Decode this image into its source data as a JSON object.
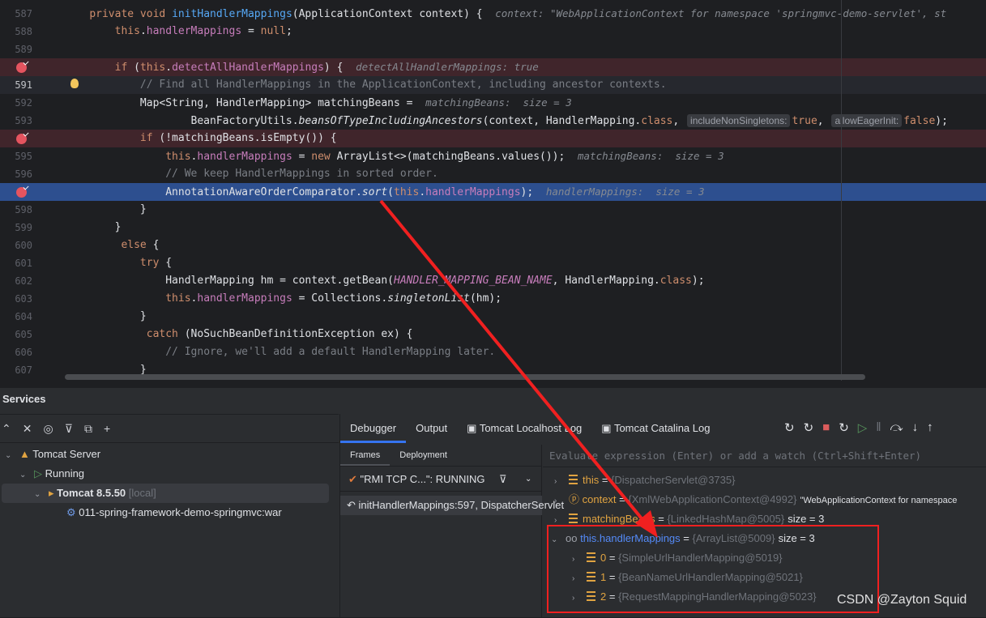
{
  "editor": {
    "lines": [
      {
        "num": "587",
        "t": [
          [
            "",
            "    "
          ],
          [
            "kw",
            "private void "
          ],
          [
            "md",
            "initHandlerMappings"
          ],
          [
            "",
            "(ApplicationContext context) {  "
          ],
          [
            "hint",
            "context: \"WebApplicationContext for namespace 'springmvc-demo-servlet', st"
          ]
        ]
      },
      {
        "num": "588",
        "t": [
          [
            "",
            "        "
          ],
          [
            "kw",
            "this"
          ],
          [
            "",
            "."
          ],
          [
            "fd",
            "handlerMappings"
          ],
          [
            "",
            " = "
          ],
          [
            "kw",
            "null"
          ],
          [
            "",
            ";"
          ]
        ]
      },
      {
        "num": "589",
        "t": []
      },
      {
        "num": "590",
        "bp": true,
        "t": [
          [
            "",
            "        "
          ],
          [
            "kw",
            "if "
          ],
          [
            "",
            "("
          ],
          [
            "kw",
            "this"
          ],
          [
            "",
            "."
          ],
          [
            "fd",
            "detectAllHandlerMappings"
          ],
          [
            "",
            ") {  "
          ],
          [
            "hint",
            "detectAllHandlerMappings: true"
          ]
        ]
      },
      {
        "num": "591",
        "caret": true,
        "bulb": true,
        "t": [
          [
            "",
            "            "
          ],
          [
            "cm",
            "// Find all HandlerMappings in the ApplicationContext, including ancestor contexts."
          ]
        ]
      },
      {
        "num": "592",
        "t": [
          [
            "",
            "            Map<String, HandlerMapping> matchingBeans =  "
          ],
          [
            "hint",
            "matchingBeans:  size = 3"
          ]
        ]
      },
      {
        "num": "593",
        "t": [
          [
            "",
            "                    BeanFactoryUtils."
          ],
          [
            "it",
            "beansOfTypeIncludingAncestors"
          ],
          [
            "",
            "(context, HandlerMapping."
          ],
          [
            "kw",
            "class"
          ],
          [
            "",
            ", "
          ],
          [
            "pill",
            "includeNonSingletons:"
          ],
          [
            "kw",
            "true"
          ],
          [
            "",
            ", "
          ],
          [
            "pill",
            "allowEagerInit:"
          ],
          [
            "kw",
            "false"
          ],
          [
            "",
            ");"
          ]
        ]
      },
      {
        "num": "594",
        "bp": true,
        "t": [
          [
            "",
            "            "
          ],
          [
            "kw",
            "if "
          ],
          [
            "",
            "(!matchingBeans.isEmpty()) {"
          ]
        ]
      },
      {
        "num": "595",
        "t": [
          [
            "",
            "                "
          ],
          [
            "kw",
            "this"
          ],
          [
            "",
            "."
          ],
          [
            "fd",
            "handlerMappings"
          ],
          [
            "",
            " = "
          ],
          [
            "kw",
            "new "
          ],
          [
            "",
            "ArrayList<>(matchingBeans.values());  "
          ],
          [
            "hint",
            "matchingBeans:  size = 3"
          ]
        ]
      },
      {
        "num": "596",
        "t": [
          [
            "",
            "                "
          ],
          [
            "cm",
            "// We keep HandlerMappings in sorted order."
          ]
        ]
      },
      {
        "num": "597",
        "bp": true,
        "exec": true,
        "t": [
          [
            "",
            "                AnnotationAwareOrderComparator."
          ],
          [
            "it",
            "sort"
          ],
          [
            "",
            "("
          ],
          [
            "kw",
            "this"
          ],
          [
            "",
            "."
          ],
          [
            "fd",
            "handlerMappings"
          ],
          [
            "",
            ");  "
          ],
          [
            "hint",
            "handlerMappings:  size = 3"
          ]
        ]
      },
      {
        "num": "598",
        "t": [
          [
            "",
            "            }"
          ]
        ]
      },
      {
        "num": "599",
        "t": [
          [
            "",
            "        }"
          ]
        ]
      },
      {
        "num": "600",
        "t": [
          [
            "",
            "         "
          ],
          [
            "kw",
            "else "
          ],
          [
            "",
            "{"
          ]
        ]
      },
      {
        "num": "601",
        "t": [
          [
            "",
            "            "
          ],
          [
            "kw",
            "try "
          ],
          [
            "",
            "{"
          ]
        ]
      },
      {
        "num": "602",
        "t": [
          [
            "",
            "                HandlerMapping hm = context.getBean("
          ],
          [
            "fd it",
            "HANDLER_MAPPING_BEAN_NAME"
          ],
          [
            "",
            ", HandlerMapping."
          ],
          [
            "kw",
            "class"
          ],
          [
            "",
            ");"
          ]
        ]
      },
      {
        "num": "603",
        "t": [
          [
            "",
            "                "
          ],
          [
            "kw",
            "this"
          ],
          [
            "",
            "."
          ],
          [
            "fd",
            "handlerMappings"
          ],
          [
            "",
            " = Collections."
          ],
          [
            "it",
            "singletonList"
          ],
          [
            "",
            "(hm);"
          ]
        ]
      },
      {
        "num": "604",
        "t": [
          [
            "",
            "            }"
          ]
        ]
      },
      {
        "num": "605",
        "t": [
          [
            "",
            "             "
          ],
          [
            "kw",
            "catch "
          ],
          [
            "",
            "(NoSuchBeanDefinitionException ex) {"
          ]
        ]
      },
      {
        "num": "606",
        "t": [
          [
            "",
            "                "
          ],
          [
            "cm",
            "// Ignore, we'll add a default HandlerMapping later."
          ]
        ]
      },
      {
        "num": "607",
        "t": [
          [
            "",
            "            }"
          ]
        ]
      }
    ]
  },
  "services": {
    "title": "Services",
    "tree": {
      "server": "Tomcat Server",
      "running": "Running",
      "tomcat": "Tomcat 8.5.50",
      "tomcat_tag": "[local]",
      "artifact": "011-spring-framework-demo-springmvc:war"
    },
    "tabs": [
      "Debugger",
      "Output",
      "Tomcat Localhost Log",
      "Tomcat Catalina Log"
    ],
    "subtabs": [
      "Frames",
      "Deployment"
    ],
    "thread": "\"RMI TCP C...\": RUNNING",
    "frame": "initHandlerMappings:597, DispatcherServlet",
    "eval_placeholder": "Evaluate expression (Enter) or add a watch (Ctrl+Shift+Enter)",
    "vars": [
      {
        "name": "this",
        "type": "{DispatcherServlet@3735}",
        "extra": ""
      },
      {
        "name": "context",
        "type": "{XmlWebApplicationContext@4992}",
        "extra": "\"WebApplicationContext for namespace"
      },
      {
        "name": "matchingBeans",
        "type": "{LinkedHashMap@5005}",
        "extra": "size = 3"
      },
      {
        "name": "this.handlerMappings",
        "type": "{ArrayList@5009}",
        "extra": "size = 3"
      },
      {
        "name": "0",
        "type": "{SimpleUrlHandlerMapping@5019}",
        "extra": ""
      },
      {
        "name": "1",
        "type": "{BeanNameUrlHandlerMapping@5021}",
        "extra": ""
      },
      {
        "name": "2",
        "type": "{RequestMappingHandlerMapping@5023}",
        "extra": ""
      }
    ]
  },
  "watermark": "CSDN @Zayton Squid",
  "colors": {
    "annotation": "#f02020",
    "exec_line": "#2d4f8f",
    "breakpoint": "#e5545f"
  }
}
